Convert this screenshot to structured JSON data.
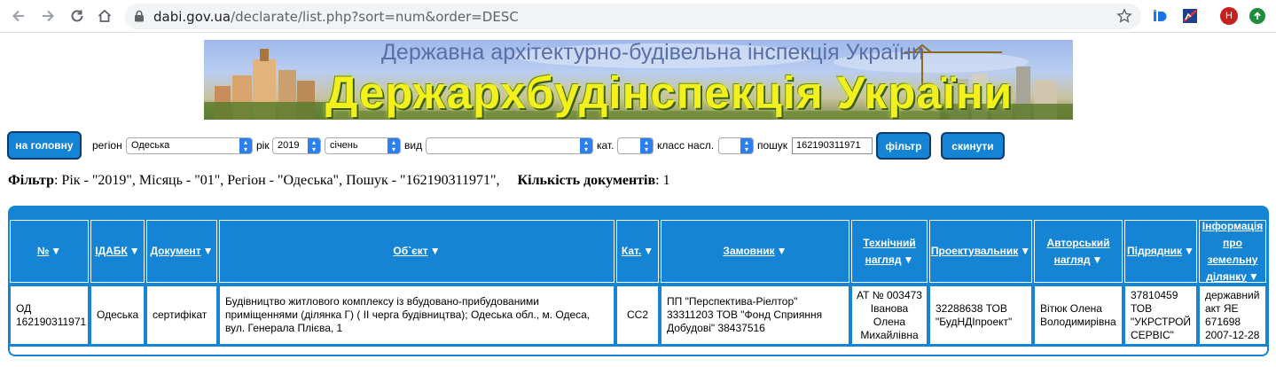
{
  "browser": {
    "url_host": "dabi.gov.ua",
    "url_path": "/declarate/list.php?sort=num&order=DESC",
    "profile_initial": "H"
  },
  "banner": {
    "subtitle": "Державна архітектурно-будівельна інспекція України",
    "title": "Держархбудінспекція України"
  },
  "filter": {
    "home_label": "на головну",
    "region_label": "регіон",
    "region_value": "Одеська",
    "year_label": "рік",
    "year_value": "2019",
    "month_value": "січень",
    "type_label": "вид",
    "type_value": "",
    "cat_label": "кат.",
    "cat_value": "",
    "class_label": "класс насл.",
    "class_value": "",
    "search_label": "пошук",
    "search_value": "162190311971",
    "filter_button": "фільтр",
    "reset_button": "скинути"
  },
  "summary": {
    "filter_bold": "Фільтр",
    "filter_text": ": Рік - \"2019\", Місяць - \"01\", Регіон - \"Одеська\", Пошук - \"162190311971\",",
    "count_bold": "Кількість документів",
    "count_text": ": 1"
  },
  "table": {
    "headers": [
      {
        "label": "№"
      },
      {
        "label": "ІДАБК"
      },
      {
        "label": "Документ"
      },
      {
        "label": "Об`єкт"
      },
      {
        "label": "Кат."
      },
      {
        "label": "Замовник"
      },
      {
        "label": "Технічний нагляд"
      },
      {
        "label": "Проектувальник"
      },
      {
        "label": "Авторський нагляд"
      },
      {
        "label": "Підрядник"
      },
      {
        "label": "Інформація про земельну ділянку"
      }
    ],
    "rows": [
      {
        "num": "ОД 162190311971",
        "idabk": "Одеська",
        "document": "сертифікат",
        "object": "Будівництво житлового комплексу із вбудовано-прибудованими приміщеннями (ділянка Г) ( ІІ черга будівництва); Одеська обл., м. Одеса, вул. Генерала Плієва, 1",
        "category": "СС2",
        "customer": "ПП \"Перспектива-Ріелтор\" 33311203 ТОВ \"Фонд Сприяння Добудові\" 38437516",
        "tech_supervision": "АТ № 003473 Іванова Олена Михайлівна",
        "designer": "32288638 ТОВ \"БудНДІпроект\"",
        "author_supervision": "Вітюк Олена Володимирівна",
        "contractor": "37810459 ТОВ \"УКРСТРОЙ СЕРВІС\"",
        "land_info": "державний акт ЯЕ 671698 2007-12-28"
      }
    ]
  }
}
